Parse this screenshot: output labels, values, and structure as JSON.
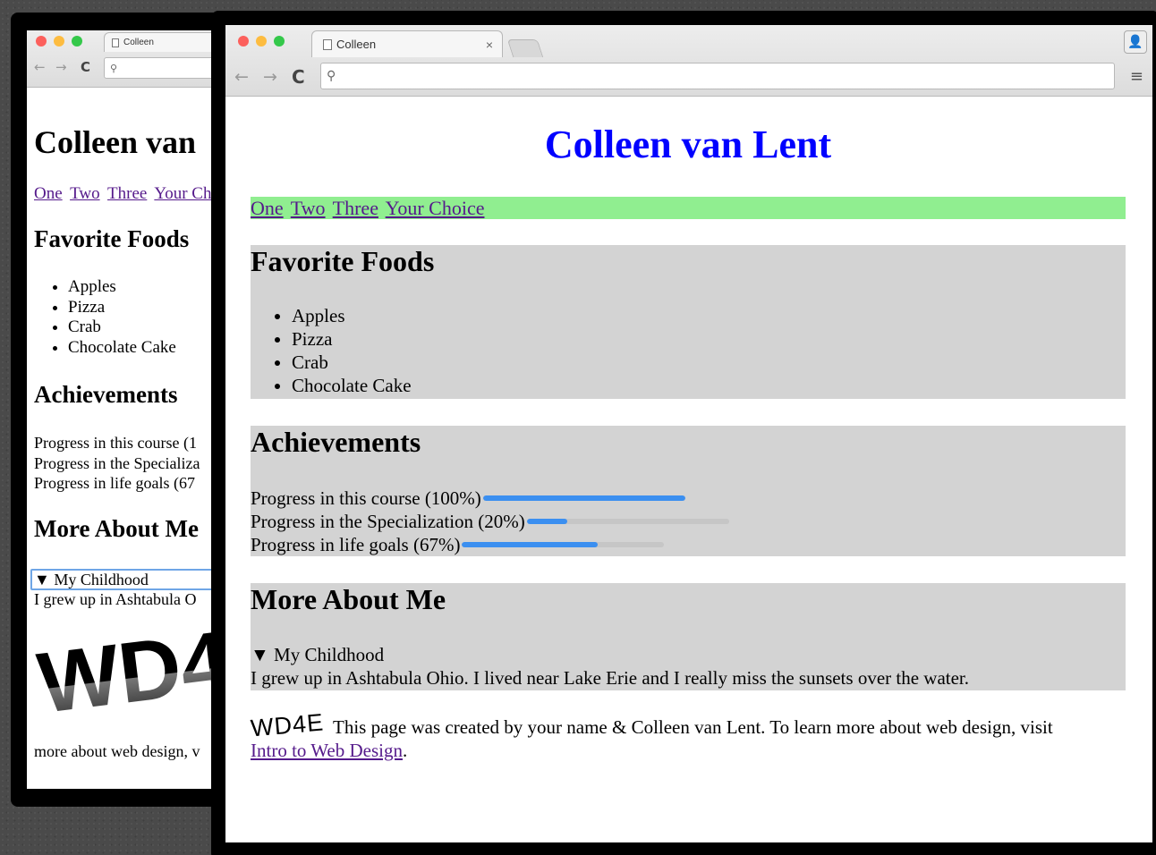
{
  "browser": {
    "tab_title": "Colleen",
    "tab_close": "×",
    "nav_back": "←",
    "nav_forward": "→",
    "nav_reload": "C",
    "search_glyph": "⚲",
    "menu_glyph": "≡",
    "profile_glyph": "👤"
  },
  "page": {
    "title": "Colleen van Lent",
    "nav_links": [
      "One",
      "Two",
      "Three",
      "Your Choice"
    ],
    "foods_heading": "Favorite Foods",
    "foods": [
      "Apples",
      "Pizza",
      "Crab",
      "Chocolate Cake"
    ],
    "achievements_heading": "Achievements",
    "progress": [
      {
        "label": "Progress in this course (100%)",
        "value": 1.0
      },
      {
        "label": "Progress in the Specialization (20%)",
        "value": 0.2
      },
      {
        "label": "Progress in life goals (67%)",
        "value": 0.67
      }
    ],
    "more_heading": "More About Me",
    "summary_marker": "▼",
    "summary": "My Childhood",
    "detail": "I grew up in Ashtabula Ohio. I lived near Lake Erie and I really miss the sunsets over the water.",
    "logo": "WD4E",
    "footer_text": "This page was created by your name & Colleen van Lent. To learn more about web design, visit",
    "footer_link": "Intro to Web Design",
    "footer_end": "."
  },
  "back_window": {
    "title_cropped": "Colleen van",
    "nav_cropped": [
      "One",
      "Two",
      "Three",
      "Your Ch"
    ],
    "more_heading_cropped": "More About Me",
    "progress_cropped": [
      "Progress in this course (1",
      "Progress in the Specializa",
      "Progress in life goals (67"
    ],
    "detail_cropped": "I grew up in Ashtabula O",
    "logo_cropped": "WD4",
    "footer_cropped": "more about web design, v"
  },
  "colors": {
    "title_blue": "#0000ff",
    "nav_green": "#90ee90",
    "section_gray": "#d3d3d3",
    "progress_blue": "#3b8ff0"
  }
}
